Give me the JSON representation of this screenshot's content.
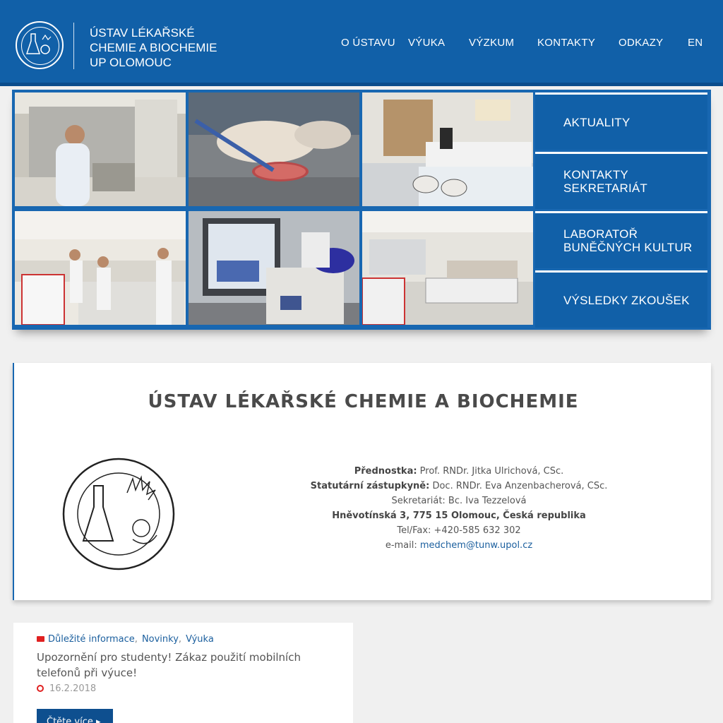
{
  "header": {
    "title_lines": [
      "ÚSTAV LÉKAŘSKÉ",
      "CHEMIE A BIOCHEMIE",
      "UP OLOMOUC"
    ],
    "nav": [
      "O ÚSTAVU",
      "VÝUKA",
      "VÝZKUM",
      "KONTAKTY",
      "ODKAZY",
      "EN"
    ]
  },
  "hero": {
    "side_menu": [
      [
        "AKTUALITY"
      ],
      [
        "KONTAKTY",
        "SEKRETARIÁT"
      ],
      [
        "LABORATOŘ",
        "BUNĚČNÝCH KULTUR"
      ],
      [
        "VÝSLEDKY ZKOUŠEK"
      ]
    ]
  },
  "info": {
    "title": "ÚSTAV LÉKAŘSKÉ CHEMIE A BIOCHEMIE",
    "head_label": "Přednostka:",
    "head_value": " Prof. RNDr. Jitka Ulrichová, CSc.",
    "deputy_label": "Statutární zástupkyně:",
    "deputy_value": " Doc. RNDr. Eva Anzenbacherová, CSc.",
    "secretary": "Sekretariát: Bc. Iva Tezzelová",
    "address": "Hněvotínská 3, 775 15 Olomouc, Česká republika",
    "phone": "Tel/Fax: +420-585 632 302",
    "email_label": "e-mail: ",
    "email": "medchem@tunw.upol.cz"
  },
  "news": {
    "categories": [
      "Důležité informace",
      "Novinky",
      "Výuka"
    ],
    "title": "Upozornění pro studenty! Zákaz použití mobilních telefonů při výuce!",
    "date": "16.2.2018",
    "read_more": "Čtěte více"
  },
  "colors": {
    "brand_blue": "#1160a8",
    "accent_red": "#e02020",
    "link": "#1b5f9e"
  }
}
